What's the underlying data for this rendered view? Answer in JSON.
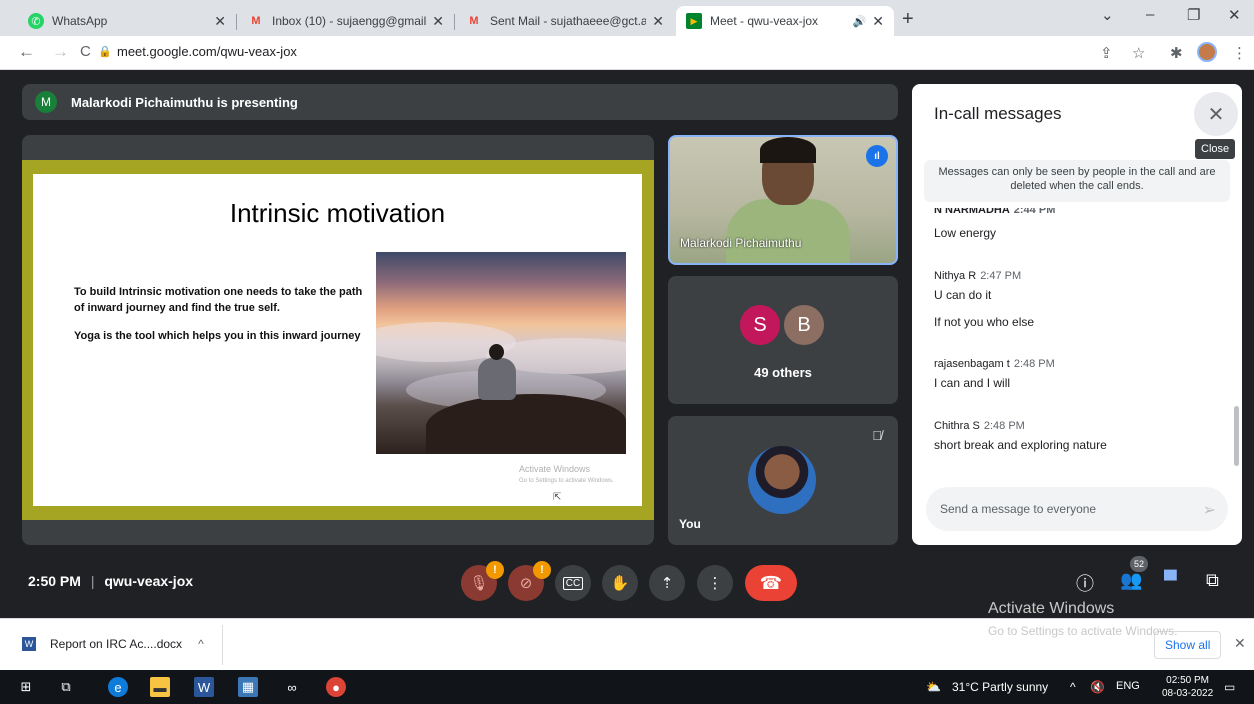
{
  "browser": {
    "tabs": [
      {
        "title": "WhatsApp",
        "icon": "whatsapp-icon",
        "active": false
      },
      {
        "title": "Inbox (10) - sujaengg@gmail.con",
        "icon": "gmail-icon",
        "active": false
      },
      {
        "title": "Sent Mail - sujathaeee@gct.ac.in",
        "icon": "gmail-icon",
        "active": false
      },
      {
        "title": "Meet - qwu-veax-jox",
        "icon": "meet-icon",
        "active": true
      }
    ],
    "url": "meet.google.com/qwu-veax-jox"
  },
  "meet": {
    "presenter_initial": "M",
    "presenting_text": "Malarkodi Pichaimuthu is presenting",
    "slide": {
      "title": "Intrinsic motivation",
      "paragraphs": [
        "To build Intrinsic motivation one needs to take the path of  inward journey and find the true self.",
        "Yoga is the tool which helps you in this inward journey"
      ],
      "watermark_line1": "Activate Windows",
      "watermark_line2": "Go to Settings to activate Windows."
    },
    "participants": {
      "speaker_name": "Malarkodi Pichaimuthu",
      "avatar1": "S",
      "avatar2": "B",
      "avatar1_color": "#c2185b",
      "avatar2_color": "#8d6e63",
      "others_label": "49 others",
      "you_label": "You"
    },
    "meeting_time": "2:50 PM",
    "meeting_code": "qwu-veax-jox",
    "people_count": "52"
  },
  "chat": {
    "title": "In-call messages",
    "close_tooltip": "Close",
    "notice": "Messages can only be seen by people in the call and are deleted when the call ends.",
    "cut_sender": "N NARMADHA",
    "cut_time": "2:44 PM",
    "messages": [
      {
        "text": "Low energy"
      },
      {
        "sender": "Nithya R",
        "time": "2:47 PM",
        "text": "U can do it"
      },
      {
        "text": "If not you who else"
      },
      {
        "sender": "rajasenbagam t",
        "time": "2:48 PM",
        "text": "I can and I will"
      },
      {
        "sender": "Chithra S",
        "time": "2:48 PM",
        "text": "short break and exploring nature"
      }
    ],
    "input_placeholder": "Send a message to everyone"
  },
  "windows": {
    "activate_title": "Activate Windows",
    "activate_sub": "Go to Settings to activate Windows."
  },
  "downloads": {
    "file": "Report on IRC Ac....docx",
    "show_all": "Show all"
  },
  "taskbar": {
    "weather": "31°C  Partly sunny",
    "lang": "ENG",
    "time": "02:50 PM",
    "date": "08-03-2022"
  }
}
